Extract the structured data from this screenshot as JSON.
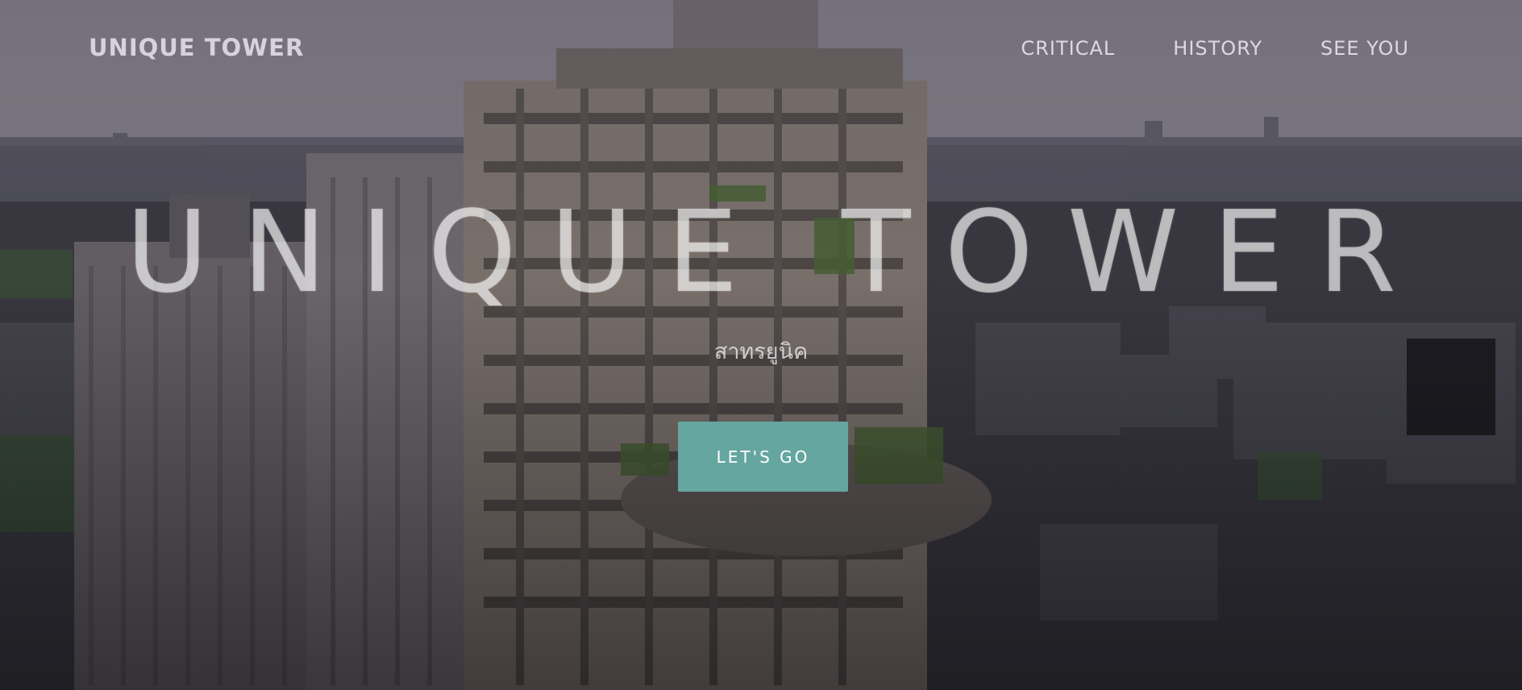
{
  "navbar": {
    "brand": "UNIQUE TOWER",
    "links": [
      "CRITICAL",
      "HISTORY",
      "SEE YOU"
    ]
  },
  "hero": {
    "title": "UNIQUE TOWER",
    "subtitle": "สาทรยูนิค",
    "cta_label": "LET'S GO"
  },
  "colors": {
    "accent": "#66a6a0",
    "nav_text": "#dcd9e0"
  }
}
